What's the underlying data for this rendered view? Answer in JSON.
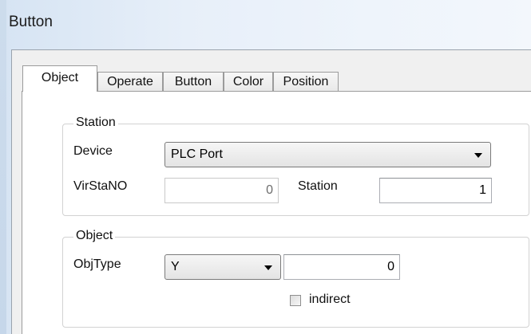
{
  "window": {
    "title": "Button"
  },
  "tabs": [
    {
      "label": "Object",
      "active": true
    },
    {
      "label": "Operate",
      "active": false
    },
    {
      "label": "Button",
      "active": false
    },
    {
      "label": "Color",
      "active": false
    },
    {
      "label": "Position",
      "active": false
    }
  ],
  "station_group": {
    "title": "Station",
    "device_label": "Device",
    "device_value": "PLC Port",
    "virstano_label": "VirStaNO",
    "virstano_value": "0",
    "station_label": "Station",
    "station_value": "1"
  },
  "object_group": {
    "title": "Object",
    "objtype_label": "ObjType",
    "objtype_value": "Y",
    "address_value": "0",
    "indirect_label": "indirect",
    "indirect_checked": false
  }
}
